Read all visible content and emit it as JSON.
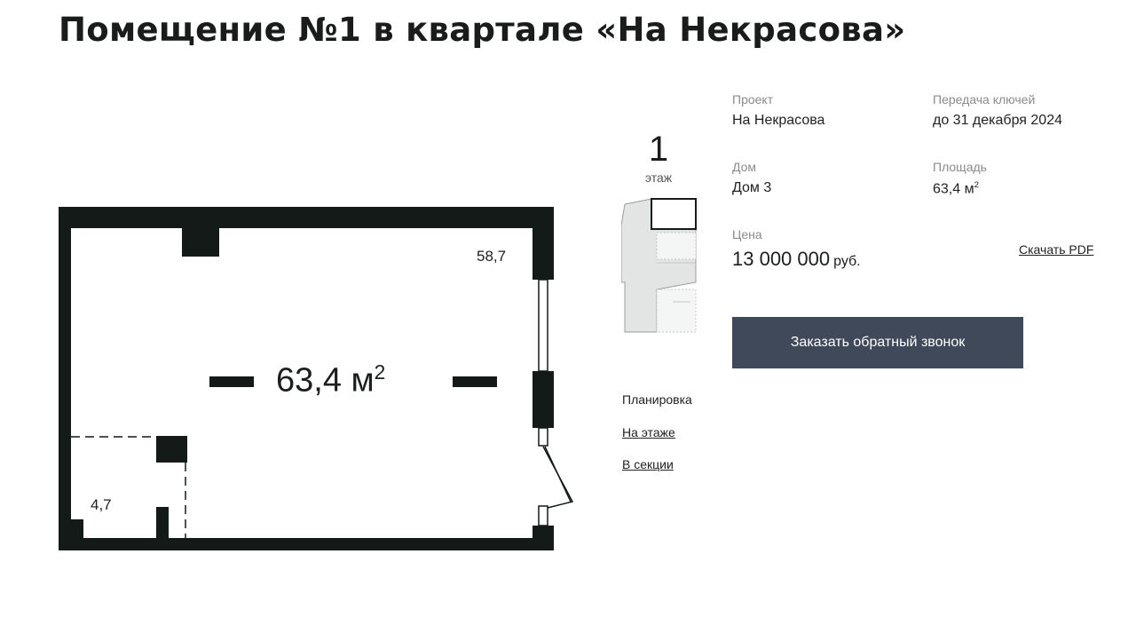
{
  "page": {
    "title": "Помещение №1 в квартале «На Некрасова»"
  },
  "floor_plan": {
    "total_area": "63,4 м",
    "total_area_sup": "2",
    "room_main_area": "58,7",
    "room_small_area": "4,7"
  },
  "floor": {
    "number": "1",
    "caption": "этаж"
  },
  "views": {
    "label": "Планировка",
    "on_floor": "На этаже",
    "in_section": "В секции"
  },
  "info": {
    "project_label": "Проект",
    "project_value": "На Некрасова",
    "keys_label": "Передача ключей",
    "keys_value": "до 31 декабря 2024",
    "house_label": "Дом",
    "house_value": "Дом 3",
    "area_label": "Площадь",
    "area_value": "63,4 м",
    "area_sup": "2",
    "price_label": "Цена",
    "price_value": "13 000 000",
    "price_currency": "руб."
  },
  "actions": {
    "download_pdf": "Скачать PDF",
    "callback": "Заказать обратный звонок"
  },
  "colors": {
    "wall": "#141a17",
    "button_bg": "#404959",
    "label_gray": "#8b8b8b"
  }
}
